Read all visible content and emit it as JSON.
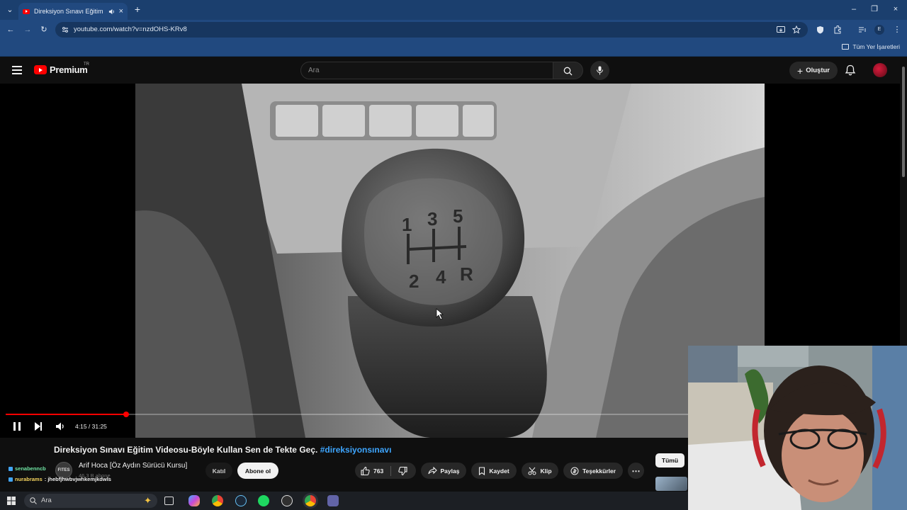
{
  "browser": {
    "tab_title": "Direksiyon Sınavı Eğitim Vid",
    "url": "youtube.com/watch?v=nzdOHS-KRv8",
    "bookmarks_label": "Tüm Yer İşaretleri",
    "profile_initial": "E"
  },
  "youtube": {
    "logo_text": "Premium",
    "country_code": "TR",
    "search_placeholder": "Ara",
    "create_label": "Oluştur"
  },
  "player": {
    "time_current": "4:15",
    "time_total": "31:25",
    "time_display": "4:15 / 31:25",
    "progress": 0.1353,
    "gear_labels": [
      "1",
      "3",
      "5",
      "2",
      "4",
      "R"
    ]
  },
  "video": {
    "title": "Direksiyon Sınavı Eğitim Videosu-Böyle Kullan Sen de Tekte Geç.",
    "hashtag": "#direksiyonsınavı",
    "channel_name": "Arif Hoca [Öz Aydın Sürücü Kursu]",
    "subscribers": "46,3 B abone",
    "channel_avatar_text": "FITES",
    "join_label": "Katıl",
    "subscribe_label": "Abone ol",
    "likes": "763",
    "share_label": "Paylaş",
    "save_label": "Kaydet",
    "clip_label": "Klip",
    "thanks_label": "Teşekkürler",
    "filter_all_label": "Tümü"
  },
  "chat": [
    {
      "user": "senabenncb",
      "message": ""
    },
    {
      "user": "nurabrams",
      "message": ": jhebfjhwbvjwhkemjkdwls"
    }
  ],
  "taskbar": {
    "search_placeholder": "Ara"
  },
  "colors": {
    "accent_red": "#ff0000",
    "link_blue": "#3ea6ff",
    "chrome_blue": "#21497f"
  }
}
